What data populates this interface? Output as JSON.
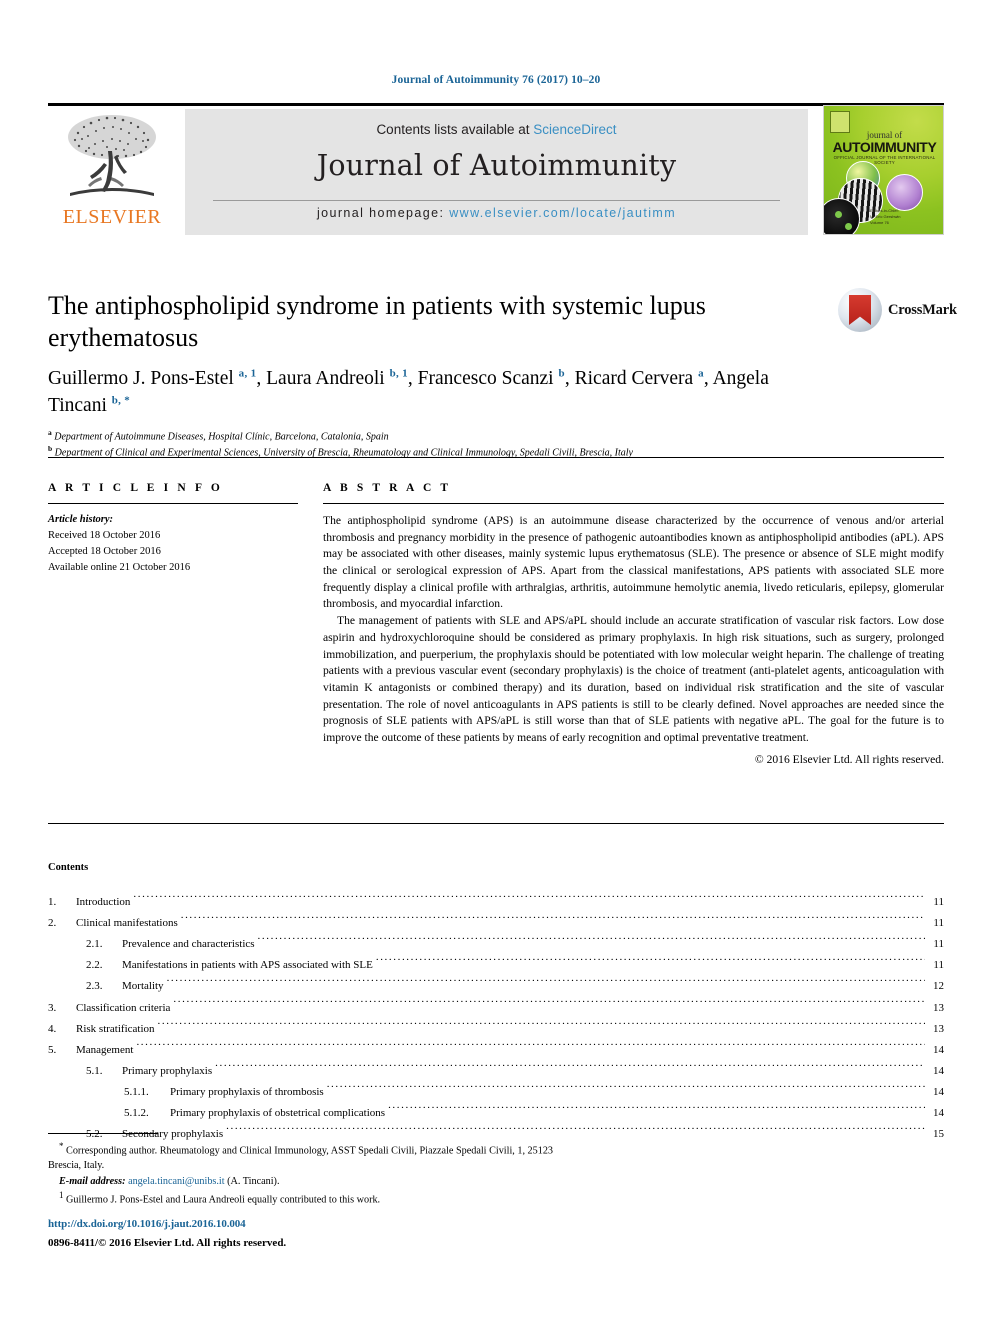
{
  "running_head": "Journal of Autoimmunity 76 (2017) 10–20",
  "masthead": {
    "publisher_logo_name": "ELSEVIER",
    "contents_prefix": "Contents lists available at ",
    "contents_link": "ScienceDirect",
    "journal_title": "Journal of Autoimmunity",
    "homepage_label": "journal homepage: ",
    "homepage_url": "www.elsevier.com/locate/jautimm",
    "cover": {
      "kicker": "journal of",
      "name": "AUTOIMMUNITY",
      "subtitle": "OFFICIAL JOURNAL OF THE INTERNATIONAL SOCIETY",
      "footer_line1": "Editors-in-Chief:",
      "footer_line2": "M. Eric Gershwin",
      "footer_line3": "Volume 76"
    }
  },
  "crossmark": {
    "label": "CrossMark"
  },
  "article": {
    "title": "The antiphospholipid syndrome in patients with systemic lupus erythematosus",
    "authors": [
      {
        "name": "Guillermo J. Pons-Estel",
        "marks": "a, 1",
        "sep": ", "
      },
      {
        "name": "Laura Andreoli",
        "marks": "b, 1",
        "sep": ", "
      },
      {
        "name": "Francesco Scanzi",
        "marks": "b",
        "sep": ", "
      },
      {
        "name": "Ricard Cervera",
        "marks": "a",
        "sep": ", "
      },
      {
        "name": "Angela Tincani",
        "marks": "b, *",
        "sep": ""
      }
    ],
    "affiliations": [
      {
        "mark": "a",
        "text": "Department of Autoimmune Diseases, Hospital Clínic, Barcelona, Catalonia, Spain"
      },
      {
        "mark": "b",
        "text": "Department of Clinical and Experimental Sciences, University of Brescia, Rheumatology and Clinical Immunology, Spedali Civili, Brescia, Italy"
      }
    ]
  },
  "article_info": {
    "heading": "A R T I C L E  I N F O",
    "history_label": "Article history:",
    "received": "Received 18 October 2016",
    "accepted": "Accepted 18 October 2016",
    "available": "Available online 21 October 2016"
  },
  "abstract": {
    "heading": "A B S T R A C T",
    "paragraph1": "The antiphospholipid syndrome (APS) is an autoimmune disease characterized by the occurrence of venous and/or arterial thrombosis and pregnancy morbidity in the presence of pathogenic autoantibodies known as antiphospholipid antibodies (aPL). APS may be associated with other diseases, mainly systemic lupus erythematosus (SLE). The presence or absence of SLE might modify the clinical or serological expression of APS. Apart from the classical manifestations, APS patients with associated SLE more frequently display a clinical profile with arthralgias, arthritis, autoimmune hemolytic anemia, livedo reticularis, epilepsy, glomerular thrombosis, and myocardial infarction.",
    "paragraph2": "The management of patients with SLE and APS/aPL should include an accurate stratification of vascular risk factors. Low dose aspirin and hydroxychloroquine should be considered as primary prophylaxis. In high risk situations, such as surgery, prolonged immobilization, and puerperium, the prophylaxis should be potentiated with low molecular weight heparin. The challenge of treating patients with a previous vascular event (secondary prophylaxis) is the choice of treatment (anti-platelet agents, anticoagulation with vitamin K antagonists or combined therapy) and its duration, based on individual risk stratification and the site of vascular presentation. The role of novel anticoagulants in APS patients is still to be clearly defined. Novel approaches are needed since the prognosis of SLE patients with APS/aPL is still worse than that of SLE patients with negative aPL. The goal for the future is to improve the outcome of these patients by means of early recognition and optimal preventative treatment.",
    "copyright": "© 2016 Elsevier Ltd. All rights reserved."
  },
  "contents": {
    "heading": "Contents",
    "entries": [
      {
        "level": 1,
        "number": "1.",
        "text": "Introduction",
        "page": "11"
      },
      {
        "level": 1,
        "number": "2.",
        "text": "Clinical manifestations",
        "page": "11"
      },
      {
        "level": 2,
        "number": "2.1.",
        "text": "Prevalence and characteristics",
        "page": "11"
      },
      {
        "level": 2,
        "number": "2.2.",
        "text": "Manifestations in patients with APS associated with SLE",
        "page": "11"
      },
      {
        "level": 2,
        "number": "2.3.",
        "text": "Mortality",
        "page": "12"
      },
      {
        "level": 1,
        "number": "3.",
        "text": "Classification criteria",
        "page": "13"
      },
      {
        "level": 1,
        "number": "4.",
        "text": "Risk stratification",
        "page": "13"
      },
      {
        "level": 1,
        "number": "5.",
        "text": "Management",
        "page": "14"
      },
      {
        "level": 2,
        "number": "5.1.",
        "text": "Primary prophylaxis",
        "page": "14"
      },
      {
        "level": 3,
        "number": "5.1.1.",
        "text": "Primary prophylaxis of thrombosis",
        "page": "14"
      },
      {
        "level": 3,
        "number": "5.1.2.",
        "text": "Primary prophylaxis of obstetrical complications",
        "page": "14"
      },
      {
        "level": 2,
        "number": "5.2.",
        "text": "Secondary prophylaxis",
        "page": "15"
      }
    ]
  },
  "footnotes": {
    "corresponding": "Corresponding author. Rheumatology and Clinical Immunology, ASST Spedali Civili, Piazzale Spedali Civili, 1, 25123 Brescia, Italy.",
    "email_label": "E-mail address:",
    "email": "angela.tincani@unibs.it",
    "email_suffix": "(A. Tincani).",
    "equal_contrib_mark": "1",
    "equal_contrib": "Guillermo J. Pons-Estel and Laura Andreoli equally contributed to this work."
  },
  "footer": {
    "doi": "http://dx.doi.org/10.1016/j.jaut.2016.10.004",
    "issn_copyright": "0896-8411/© 2016 Elsevier Ltd. All rights reserved."
  },
  "colors": {
    "link": "#1a6496",
    "science_direct": "#3a8fc3",
    "elsevier_orange": "#e87722",
    "panel_grey": "#e4e4e4"
  }
}
